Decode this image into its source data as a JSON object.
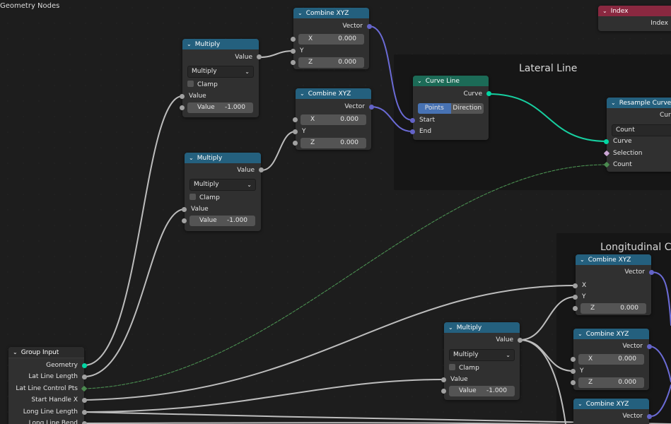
{
  "editor_title": "Geometry Nodes",
  "frames": {
    "lateral": "Lateral Line",
    "longitudinal": "Longitudinal  C"
  },
  "nodes": {
    "combine_top": {
      "title": "Combine XYZ",
      "output": "Vector",
      "x_label": "X",
      "x_value": "0.000",
      "y_label": "Y",
      "z_label": "Z",
      "z_value": "0.000"
    },
    "multiply_top": {
      "title": "Multiply",
      "output": "Value",
      "operation": "Multiply",
      "clamp": "Clamp",
      "input_label": "Value",
      "field_label": "Value",
      "field_value": "-1.000"
    },
    "combine_mid": {
      "title": "Combine XYZ",
      "output": "Vector",
      "x_label": "X",
      "x_value": "0.000",
      "y_label": "Y",
      "z_label": "Z",
      "z_value": "0.000"
    },
    "multiply_mid": {
      "title": "Multiply",
      "output": "Value",
      "operation": "Multiply",
      "clamp": "Clamp",
      "input_label": "Value",
      "field_label": "Value",
      "field_value": "-1.000"
    },
    "curve_line": {
      "title": "Curve Line",
      "output": "Curve",
      "mode_points": "Points",
      "mode_direction": "Direction",
      "start": "Start",
      "end": "End"
    },
    "index": {
      "title": "Index",
      "output": "Index"
    },
    "resample": {
      "title": "Resample Curve",
      "output": "Curve",
      "mode": "Count",
      "curve": "Curve",
      "selection": "Selection",
      "count": "Count"
    },
    "combine_long1": {
      "title": "Combine XYZ",
      "output": "Vector",
      "x_label": "X",
      "y_label": "Y",
      "z_label": "Z",
      "z_value": "0.000"
    },
    "combine_long2": {
      "title": "Combine XYZ",
      "output": "Vector",
      "x_label": "X",
      "x_value": "0.000",
      "y_label": "Y",
      "z_label": "Z",
      "z_value": "0.000"
    },
    "combine_long3": {
      "title": "Combine XYZ",
      "output": "Vector"
    },
    "multiply_bottom": {
      "title": "Multiply",
      "output": "Value",
      "operation": "Multiply",
      "clamp": "Clamp",
      "input_label": "Value",
      "field_label": "Value",
      "field_value": "-1.000"
    },
    "group_input": {
      "title": "Group Input",
      "outputs": [
        "Geometry",
        "Lat Line Length",
        "Lat Line Control Pts",
        "Start Handle X",
        "Long Line Length",
        "Long Line Bend"
      ]
    }
  },
  "colors": {
    "header_vector": "#24607e",
    "header_curve": "#1c6b57",
    "header_input": "#8a2840",
    "wire_default": "#bdbdbd",
    "wire_vector": "#6b6bd6",
    "wire_geometry": "#17cfa0",
    "wire_integer": "#4f9a56"
  }
}
